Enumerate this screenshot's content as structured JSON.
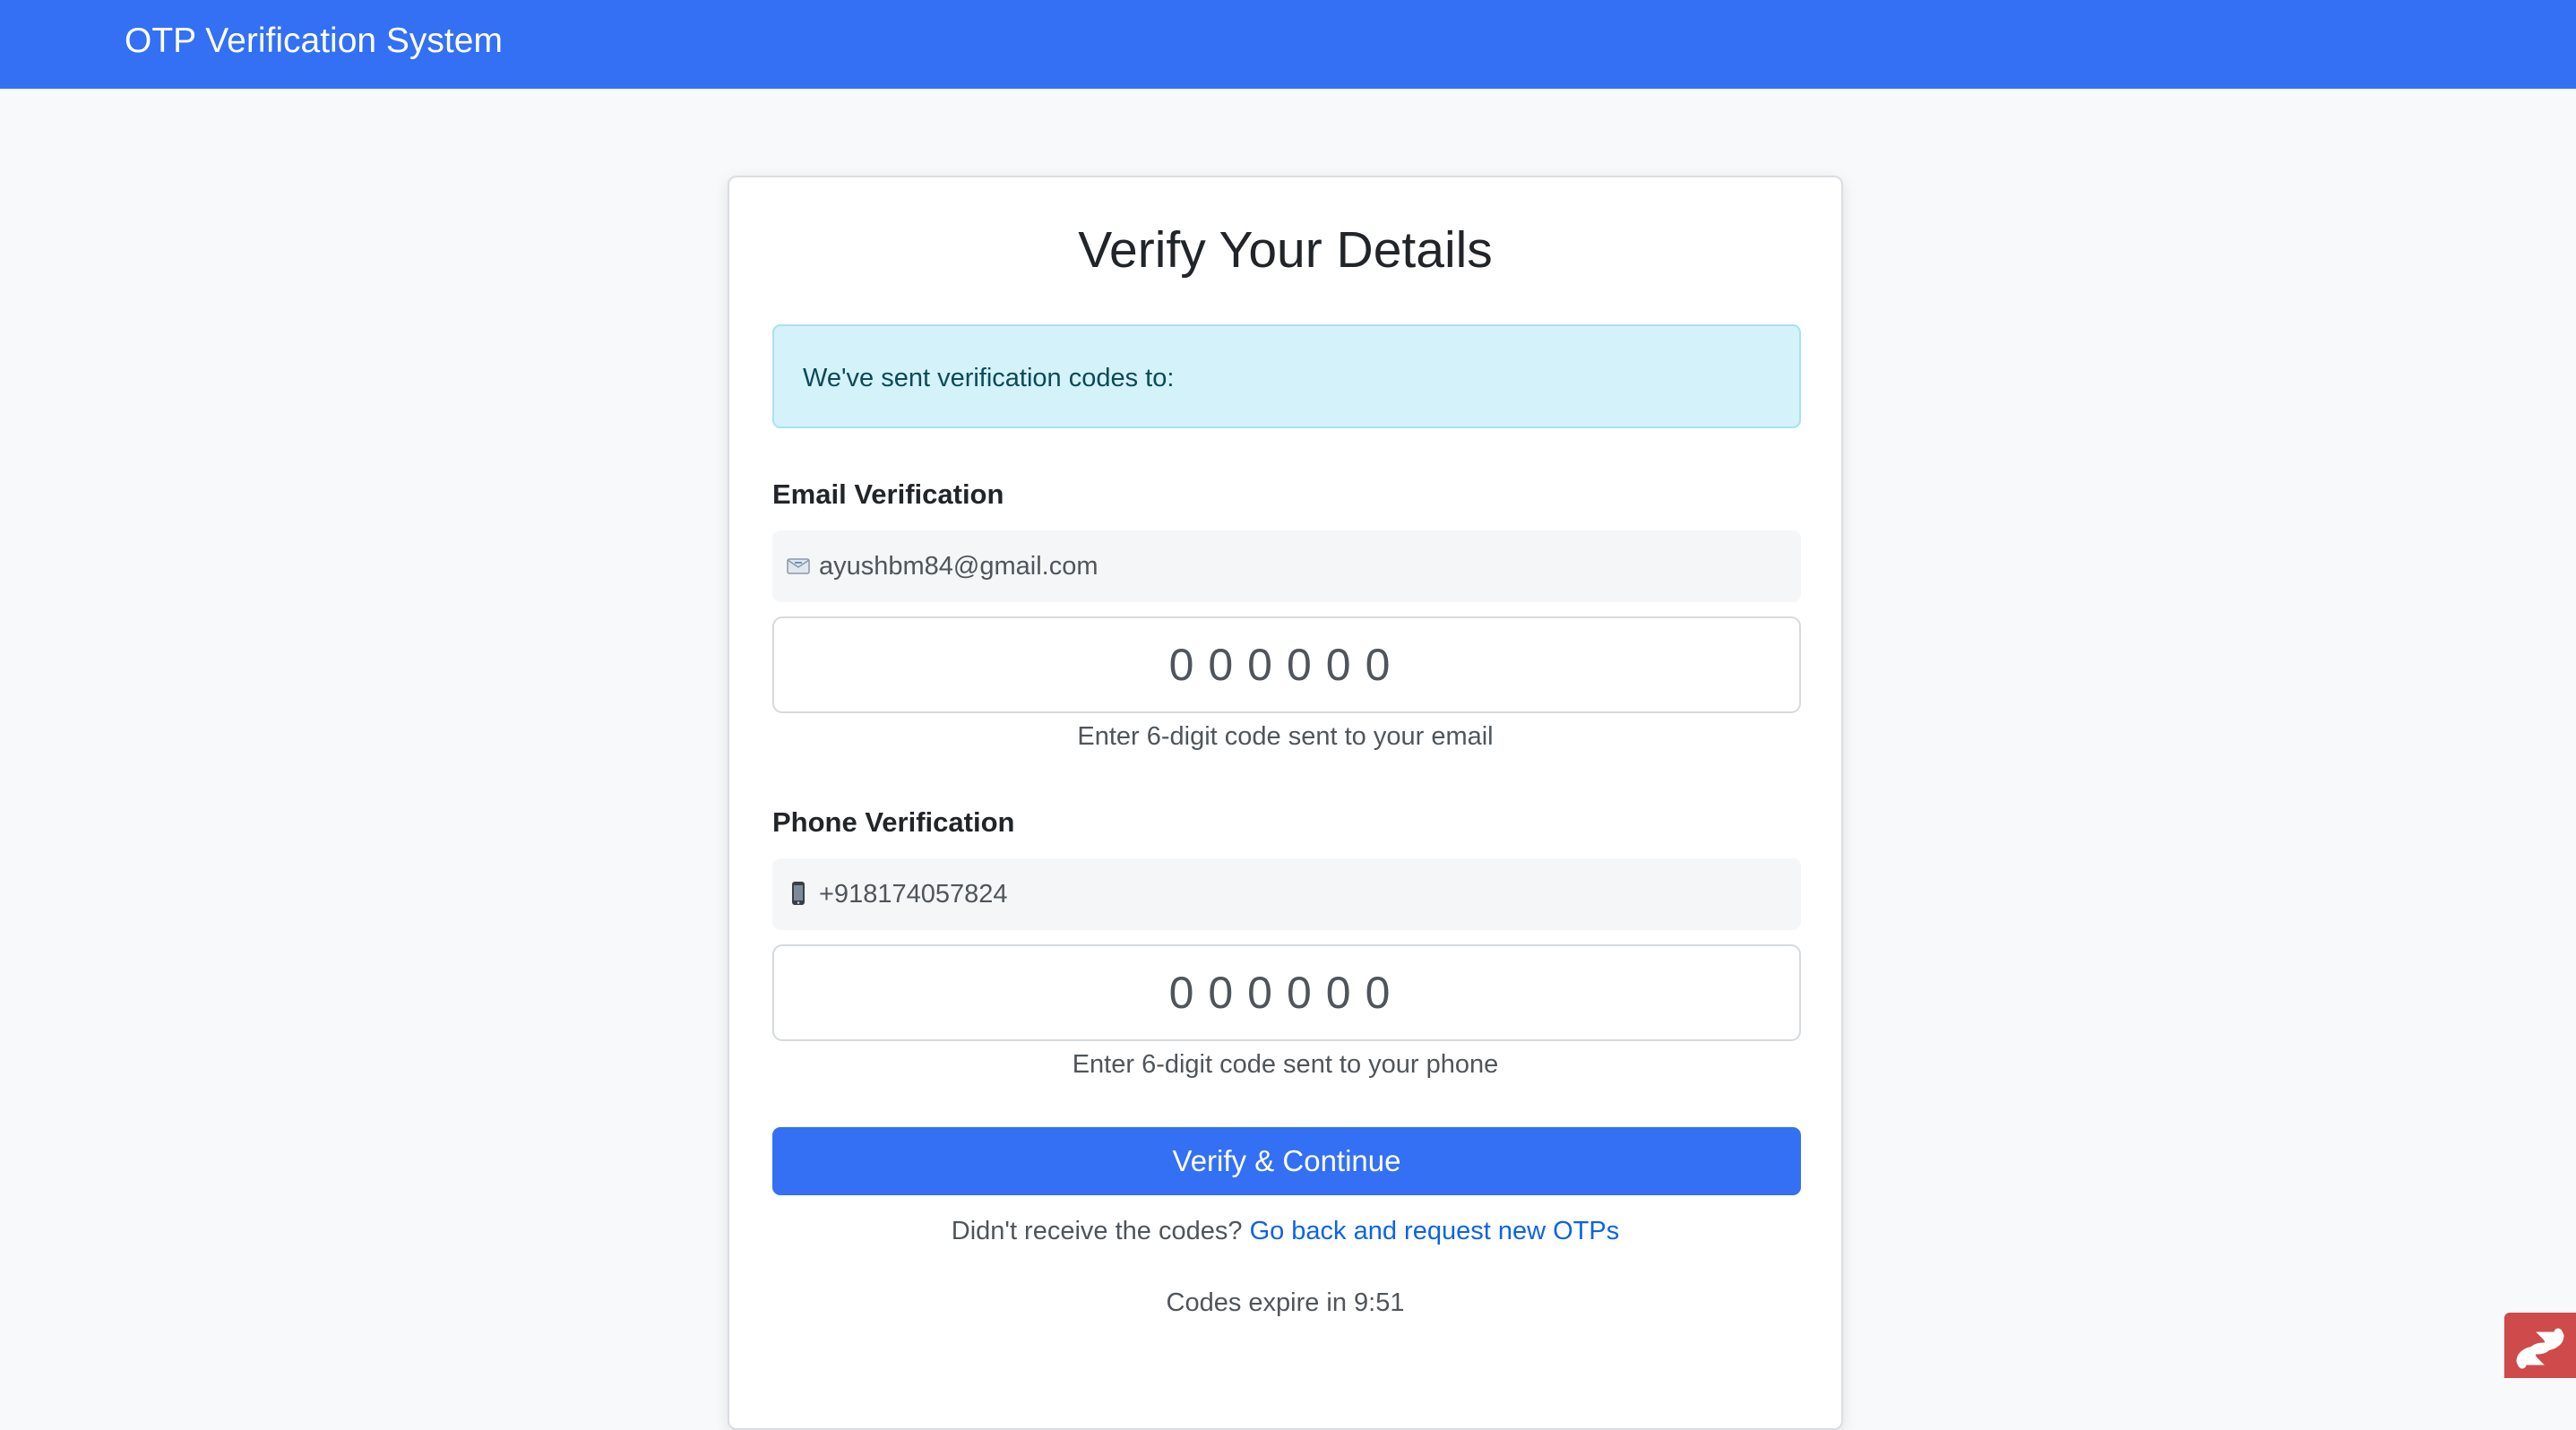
{
  "navbar": {
    "brand": "OTP Verification System"
  },
  "card": {
    "title": "Verify Your Details",
    "alert": "We've sent verification codes to:",
    "email": {
      "section_title": "Email Verification",
      "icon": "envelope-icon",
      "contact": "ayushbm84@gmail.com",
      "otp_placeholder": "000000",
      "hint": "Enter 6-digit code sent to your email"
    },
    "phone": {
      "section_title": "Phone Verification",
      "icon": "mobile-phone-icon",
      "contact": "+918174057824",
      "otp_placeholder": "000000",
      "hint": "Enter 6-digit code sent to your phone"
    },
    "verify_button": "Verify & Continue",
    "resend_prompt": "Didn't receive the codes?",
    "resend_link": "Go back and request new OTPs",
    "expiry": "Codes expire in 9:51"
  },
  "colors": {
    "primary": "#3370f4",
    "alert_bg": "#d4f2f9",
    "link": "#0d63e8",
    "corner_badge": "#cf4a4a"
  },
  "corner_badge_icon": "stackblitz-like-logo-icon"
}
